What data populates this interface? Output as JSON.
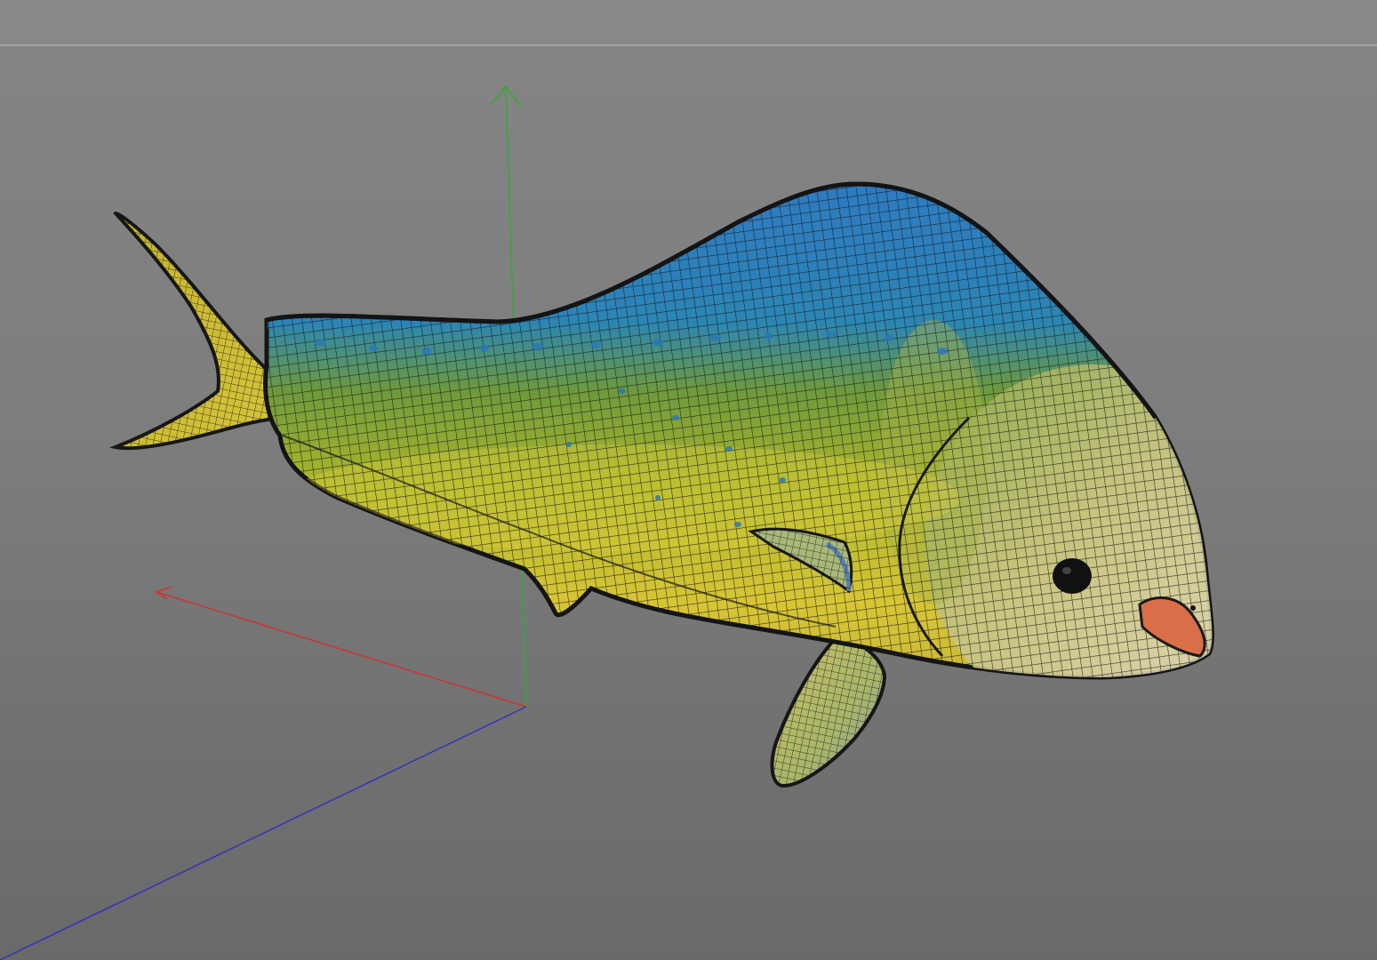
{
  "viewport": {
    "background_top": "#858585",
    "background_bottom": "#696969",
    "divider_color": "#a2a2a2"
  },
  "axes": {
    "x_color": "#cc3333",
    "y_color": "#33aa33",
    "z_color": "#3333bb"
  },
  "model": {
    "name_icon": "dolphinfish-mesh",
    "display_mode": "wireframe-on-shaded",
    "colors": {
      "back": "#2a6fb0",
      "back_light": "#3a8fc8",
      "side": "#9bb52e",
      "belly": "#d8c83a",
      "head": "#c9c28a",
      "mouth": "#d9704a",
      "wire": "#1a1a1a"
    }
  }
}
